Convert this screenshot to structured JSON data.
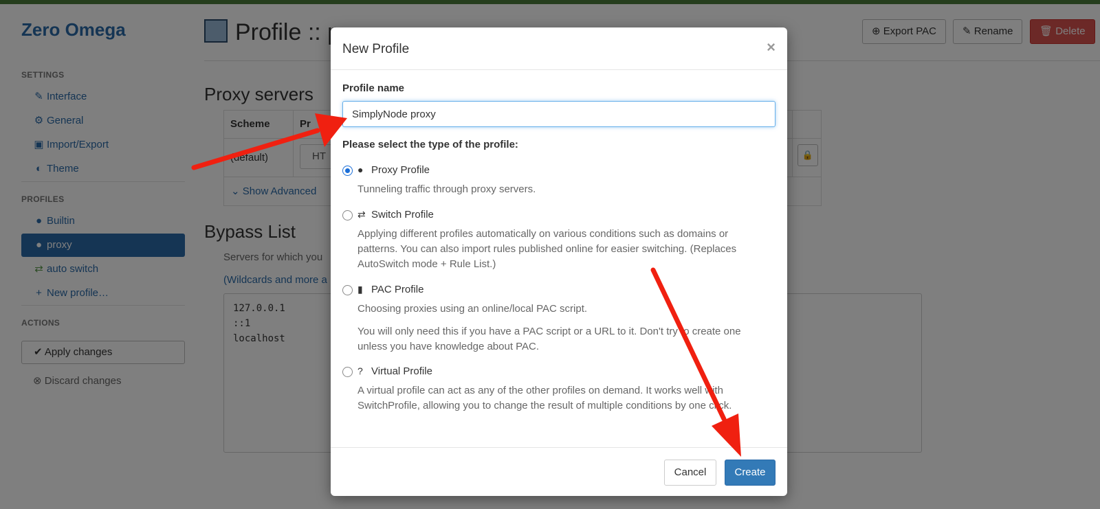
{
  "sidebar": {
    "brand": "Zero Omega",
    "settings_header": "SETTINGS",
    "settings_items": [
      {
        "label": "Interface",
        "icon": "wrench-icon"
      },
      {
        "label": "General",
        "icon": "gear-icon"
      },
      {
        "label": "Import/Export",
        "icon": "floppy-disk-icon"
      },
      {
        "label": "Theme",
        "icon": "half-circle-icon"
      }
    ],
    "profiles_header": "PROFILES",
    "profile_items": [
      {
        "label": "Builtin",
        "icon": "globe-icon"
      },
      {
        "label": "proxy",
        "icon": "globe-icon",
        "active": true
      },
      {
        "label": "auto switch",
        "icon": "switch-arrows-icon"
      },
      {
        "label": "New profile…",
        "icon": "plus-icon"
      }
    ],
    "actions_header": "ACTIONS",
    "apply_label": "Apply changes",
    "discard_label": "Discard changes"
  },
  "main": {
    "title": "Profile :: p",
    "header_buttons": {
      "export": "Export PAC",
      "rename": "Rename",
      "delete": "Delete"
    },
    "proxy_servers": {
      "heading": "Proxy servers",
      "col_scheme": "Scheme",
      "col_protocol": "Pr",
      "row_scheme": "(default)",
      "row_protocol": "HT",
      "show_advanced": "Show Advanced"
    },
    "bypass": {
      "heading": "Bypass List",
      "description": "Servers for which you",
      "link": "(Wildcards and more a",
      "entries": [
        "127.0.0.1",
        "::1",
        "localhost"
      ]
    }
  },
  "modal": {
    "title": "New Profile",
    "close": "×",
    "name_label": "Profile name",
    "name_value": "SimplyNode proxy",
    "type_label": "Please select the type of the profile:",
    "options": [
      {
        "title": "Proxy Profile",
        "icon": "globe-icon",
        "checked": true,
        "description": "Tunneling traffic through proxy servers."
      },
      {
        "title": "Switch Profile",
        "icon": "switch-arrows-icon",
        "checked": false,
        "description": "Applying different profiles automatically on various conditions such as domains or patterns. You can also import rules published online for easier switching. (Replaces AutoSwitch mode + Rule List.)"
      },
      {
        "title": "PAC Profile",
        "icon": "file-icon",
        "checked": false,
        "description": "Choosing proxies using an online/local PAC script.",
        "note": "You will only need this if you have a PAC script or a URL to it. Don't try to create one unless you have knowledge about PAC."
      },
      {
        "title": "Virtual Profile",
        "icon": "question-circle-icon",
        "checked": false,
        "description": "A virtual profile can act as any of the other profiles on demand. It works well with SwitchProfile, allowing you to change the result of multiple conditions by one click."
      }
    ],
    "cancel_label": "Cancel",
    "create_label": "Create"
  },
  "colors": {
    "brand": "#2a6aa8",
    "primary_button": "#337ab7",
    "danger_button": "#d9534f",
    "annotation_arrow": "#f02010"
  }
}
